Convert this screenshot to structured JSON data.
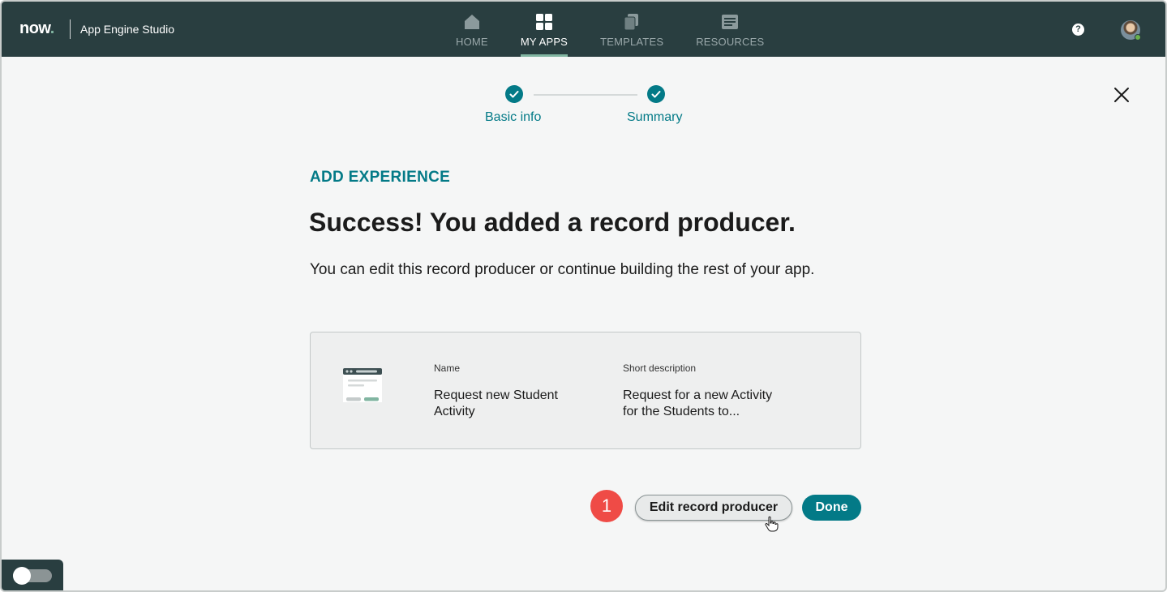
{
  "header": {
    "logo_text": "now",
    "logo_dot": ".",
    "app_title": "App Engine Studio",
    "nav": [
      {
        "label": "HOME",
        "icon": "home-icon",
        "active": false
      },
      {
        "label": "MY APPS",
        "icon": "grid-icon",
        "active": true
      },
      {
        "label": "TEMPLATES",
        "icon": "templates-icon",
        "active": false
      },
      {
        "label": "RESOURCES",
        "icon": "resources-icon",
        "active": false
      }
    ],
    "help_glyph": "?",
    "avatar_icon": "user-avatar",
    "accent_color": "#81b5a1",
    "bg_color": "#293e40"
  },
  "stepper": {
    "steps": [
      {
        "label": "Basic info",
        "complete": true
      },
      {
        "label": "Summary",
        "complete": true
      }
    ]
  },
  "content": {
    "eyebrow": "ADD EXPERIENCE",
    "headline": "Success! You added a record producer.",
    "body": "You can edit this record producer or continue building the rest of your app."
  },
  "card": {
    "icon": "record-producer-icon",
    "name_label": "Name",
    "name_value": "Request new Student Activity",
    "desc_label": "Short description",
    "desc_value": "Request for a new Activity for the Students to..."
  },
  "actions": {
    "badge": "1",
    "edit_label": "Edit record producer",
    "done_label": "Done",
    "primary_color": "#037a87"
  },
  "toggle": {
    "on": false
  }
}
